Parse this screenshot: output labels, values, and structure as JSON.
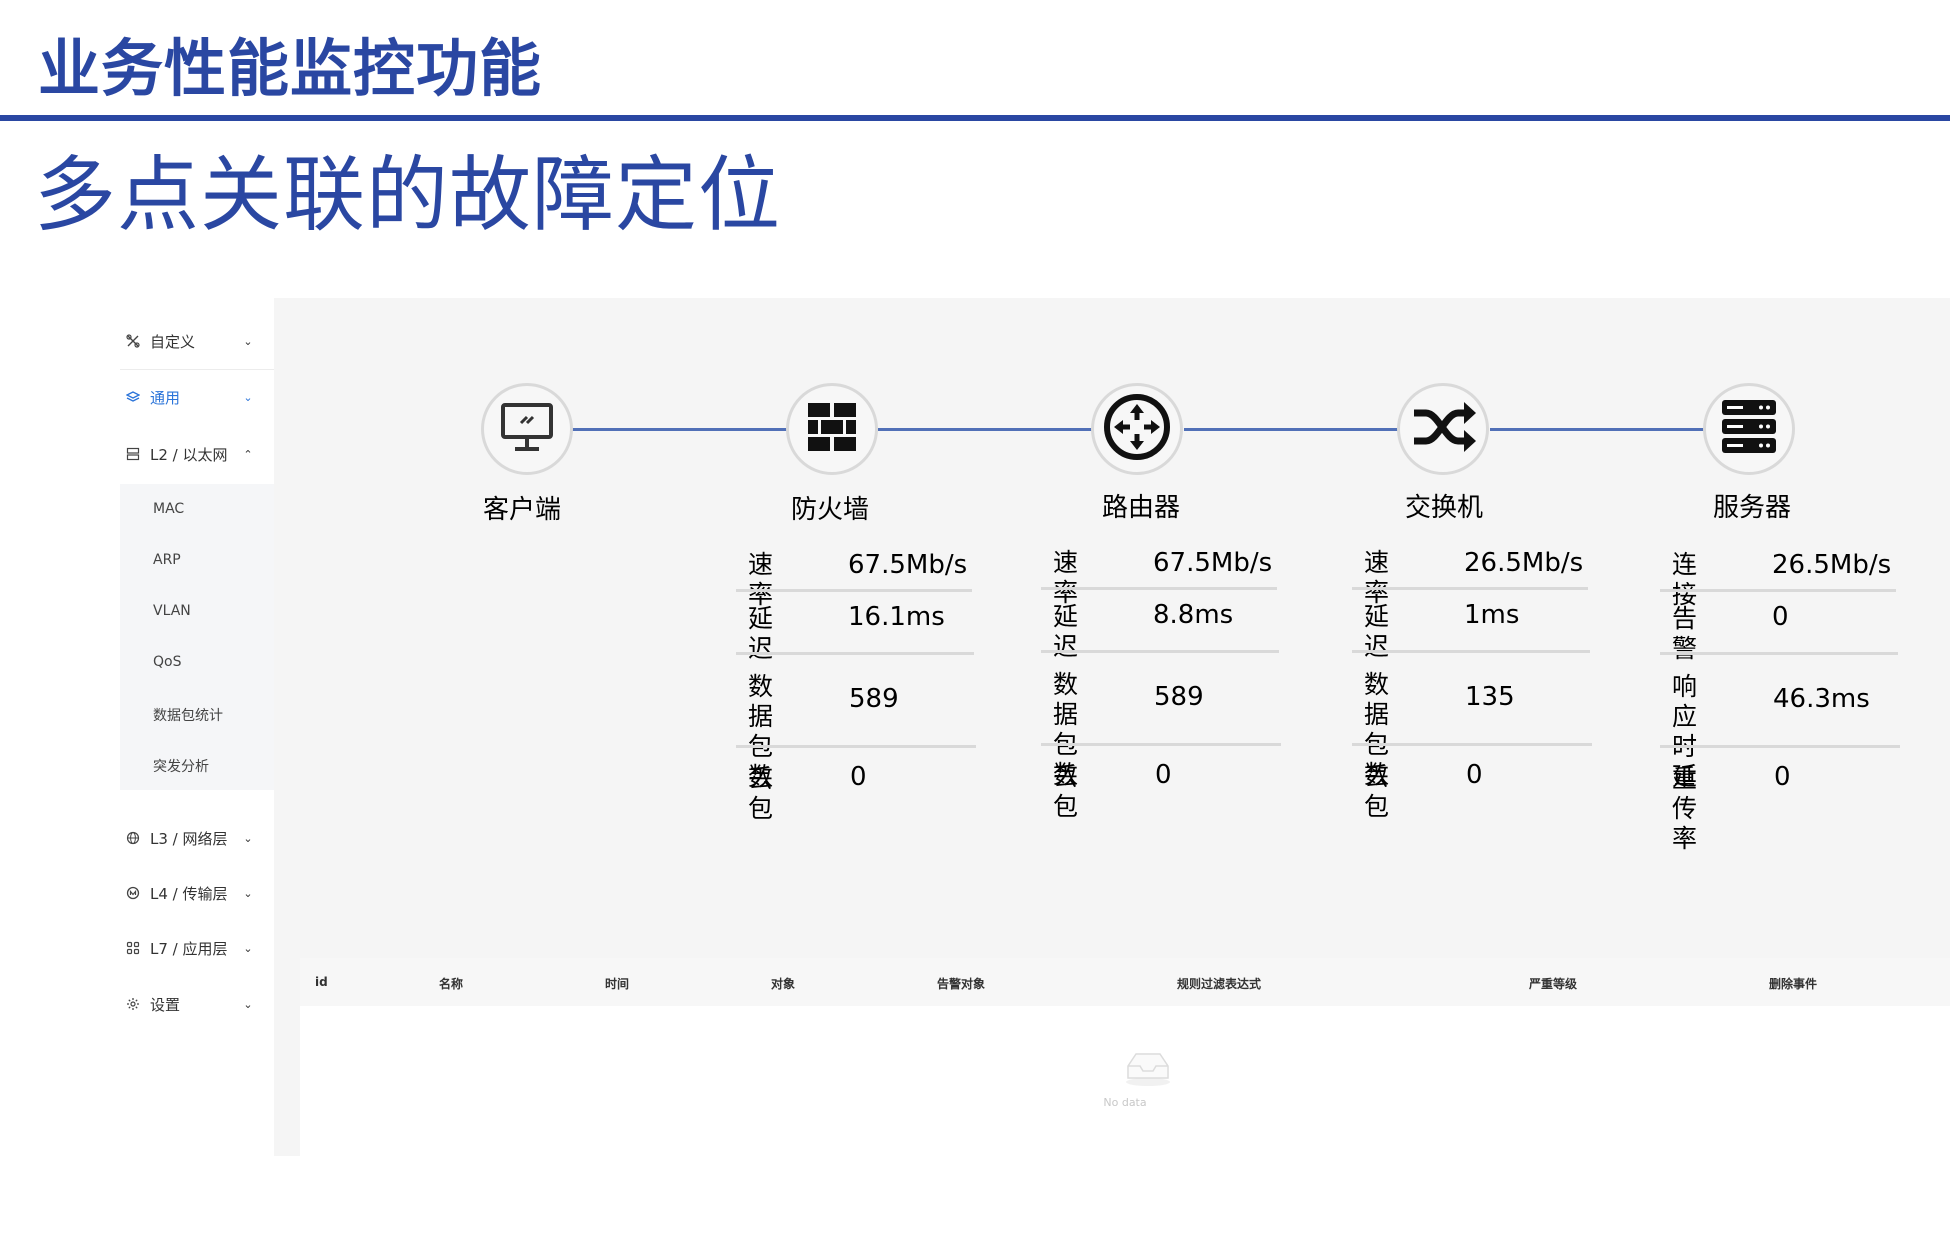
{
  "slide": {
    "title": "业务性能监控功能",
    "subtitle": "多点关联的故障定位"
  },
  "colors": {
    "brand": "#2a47a2",
    "link_line": "#5170b7",
    "active_menu": "#2b74d9"
  },
  "sidebar": {
    "items": [
      {
        "label": "自定义",
        "icon": "customize-icon",
        "arrow": "chevron-down-icon"
      },
      {
        "label": "通用",
        "icon": "layers-icon",
        "arrow": "chevron-down-icon",
        "active": true
      },
      {
        "label": "L2 / 以太网",
        "icon": "ethernet-icon",
        "arrow": "chevron-up-icon",
        "expanded": true
      },
      {
        "label": "L3 / 网络层",
        "icon": "globe-icon",
        "arrow": "chevron-down-icon"
      },
      {
        "label": "L4 / 传输层",
        "icon": "transport-icon",
        "arrow": "chevron-down-icon"
      },
      {
        "label": "L7 / 应用层",
        "icon": "apps-icon",
        "arrow": "chevron-down-icon"
      },
      {
        "label": "设置",
        "icon": "gear-icon",
        "arrow": "chevron-down-icon"
      }
    ],
    "l2_subitems": [
      "MAC",
      "ARP",
      "VLAN",
      "QoS",
      "数据包统计",
      "突发分析"
    ]
  },
  "topology": {
    "nodes": [
      {
        "label": "客户端",
        "icon": "monitor-icon"
      },
      {
        "label": "防火墙",
        "icon": "firewall-icon"
      },
      {
        "label": "路由器",
        "icon": "router-icon"
      },
      {
        "label": "交换机",
        "icon": "switch-icon"
      },
      {
        "label": "服务器",
        "icon": "server-icon"
      }
    ],
    "stats": {
      "firewall": [
        {
          "key": "速率",
          "value": "67.5Mb/s"
        },
        {
          "key": "延迟",
          "value": "16.1ms"
        },
        {
          "key": "数据\n包数",
          "value": "589"
        },
        {
          "key": "丢包",
          "value": "0"
        }
      ],
      "router": [
        {
          "key": "速率",
          "value": "67.5Mb/s"
        },
        {
          "key": "延迟",
          "value": "8.8ms"
        },
        {
          "key": "数据\n包数",
          "value": "589"
        },
        {
          "key": "丢包",
          "value": "0"
        }
      ],
      "switch": [
        {
          "key": "速率",
          "value": "26.5Mb/s"
        },
        {
          "key": "延迟",
          "value": "1ms"
        },
        {
          "key": "数据\n包数",
          "value": "135"
        },
        {
          "key": "丢包",
          "value": "0"
        }
      ],
      "server": [
        {
          "key": "连接",
          "value": "26.5Mb/s"
        },
        {
          "key": "告警",
          "value": "0"
        },
        {
          "key": "响应\n时延",
          "value": "46.3ms"
        },
        {
          "key": "重传\n率",
          "value": "0"
        }
      ]
    }
  },
  "event_table": {
    "columns": [
      "id",
      "名称",
      "时间",
      "对象",
      "告警对象",
      "规则过滤表达式",
      "严重等级",
      "删除事件"
    ],
    "empty_text": "No data"
  }
}
